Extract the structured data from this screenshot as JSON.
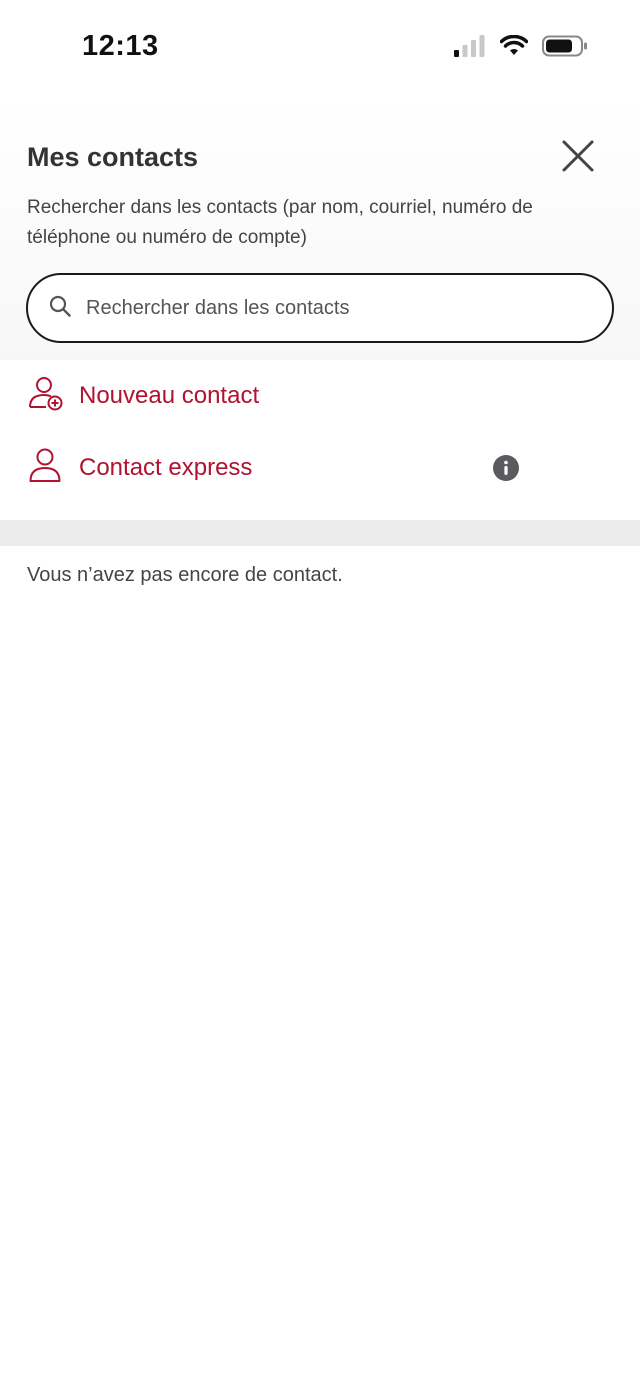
{
  "status_bar": {
    "time": "12:13",
    "icons": [
      "signal-icon",
      "wifi-icon",
      "battery-icon"
    ]
  },
  "header": {
    "title": "Mes contacts",
    "subtitle": "Rechercher dans les contacts (par nom, courriel, numéro de téléphone ou numéro de compte)",
    "close_icon": "close-icon"
  },
  "search": {
    "placeholder": "Rechercher dans les contacts",
    "value": ""
  },
  "actions": {
    "new_contact": {
      "label": "Nouveau contact",
      "icon": "add-person-icon"
    },
    "express_contact": {
      "label": "Contact express",
      "icon": "person-icon",
      "info_icon": "info-icon"
    }
  },
  "empty_state": {
    "message": "Vous n’avez pas encore de contact."
  },
  "colors": {
    "accent": "#b0122f",
    "text": "#333333",
    "divider": "#ececec"
  }
}
